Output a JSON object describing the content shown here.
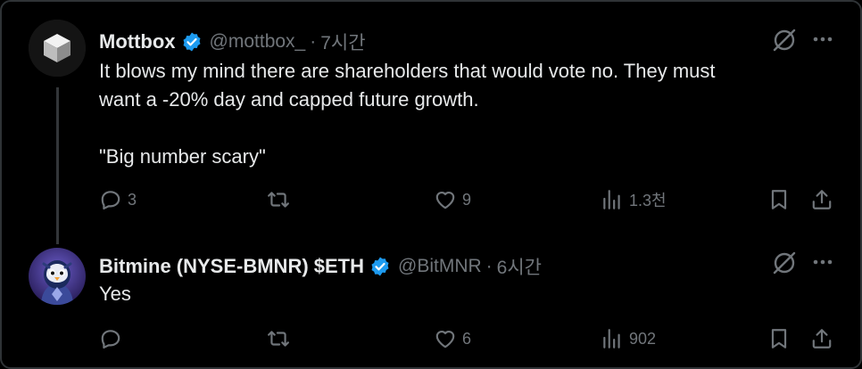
{
  "tweets": [
    {
      "name": "Mottbox",
      "handle": "@mottbox_",
      "separator": "·",
      "time": "7시간",
      "text": "It blows my mind there are shareholders that would vote no. They must\nwant a -20% day and capped future growth.\n\n\"Big number scary\"",
      "replies": "3",
      "reposts": "",
      "likes": "9",
      "views": "1.3천"
    },
    {
      "name": "Bitmine (NYSE-BMNR) $ETH",
      "handle": "@BitMNR",
      "separator": "·",
      "time": "6시간",
      "text": "Yes",
      "replies": "",
      "reposts": "",
      "likes": "6",
      "views": "902"
    }
  ],
  "colors": {
    "verified": "#1d9bf0",
    "text": "#e7e9ea",
    "muted": "#71767b",
    "background": "#000000"
  },
  "icons": [
    "verified-badge-icon",
    "grok-icon",
    "more-icon",
    "reply-icon",
    "repost-icon",
    "like-icon",
    "views-icon",
    "bookmark-icon",
    "share-icon"
  ]
}
